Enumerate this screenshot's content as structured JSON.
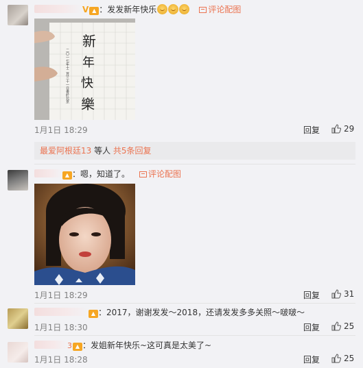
{
  "comments": [
    {
      "text": "：发发新年快乐",
      "username_tail": "",
      "pic_label": "评论配图",
      "emoji": [
        "grin-emoji",
        "grin-emoji",
        "grin-emoji"
      ],
      "time": "1月1日 18:29",
      "reply_label": "回复",
      "likes": "29",
      "card_lines": [
        "新",
        "年",
        "快",
        "樂"
      ],
      "card_side": "二〇一七年十二月三十一日書於北京"
    },
    {
      "text": "：嗯，知道了。",
      "pic_label": "评论配图",
      "time": "1月1日 18:29",
      "reply_label": "回复",
      "likes": "31"
    },
    {
      "text": "：2017，谢谢发发～2018，还请发发多多关照～啵啵～",
      "time": "1月1日 18:30",
      "reply_label": "回复",
      "likes": "25"
    },
    {
      "username_tail": "3",
      "text": "：发姐新年快乐~这可真是太美了~",
      "time": "1月1日 18:28",
      "reply_label": "回复",
      "likes": "25"
    }
  ],
  "more_replies": {
    "user": "最爱阿根廷13",
    "middle": " 等人 ",
    "count": "共5条回复"
  },
  "colors": {
    "accent": "#eb7350",
    "bg": "#f2f2f5",
    "vip": "#f6a623"
  }
}
